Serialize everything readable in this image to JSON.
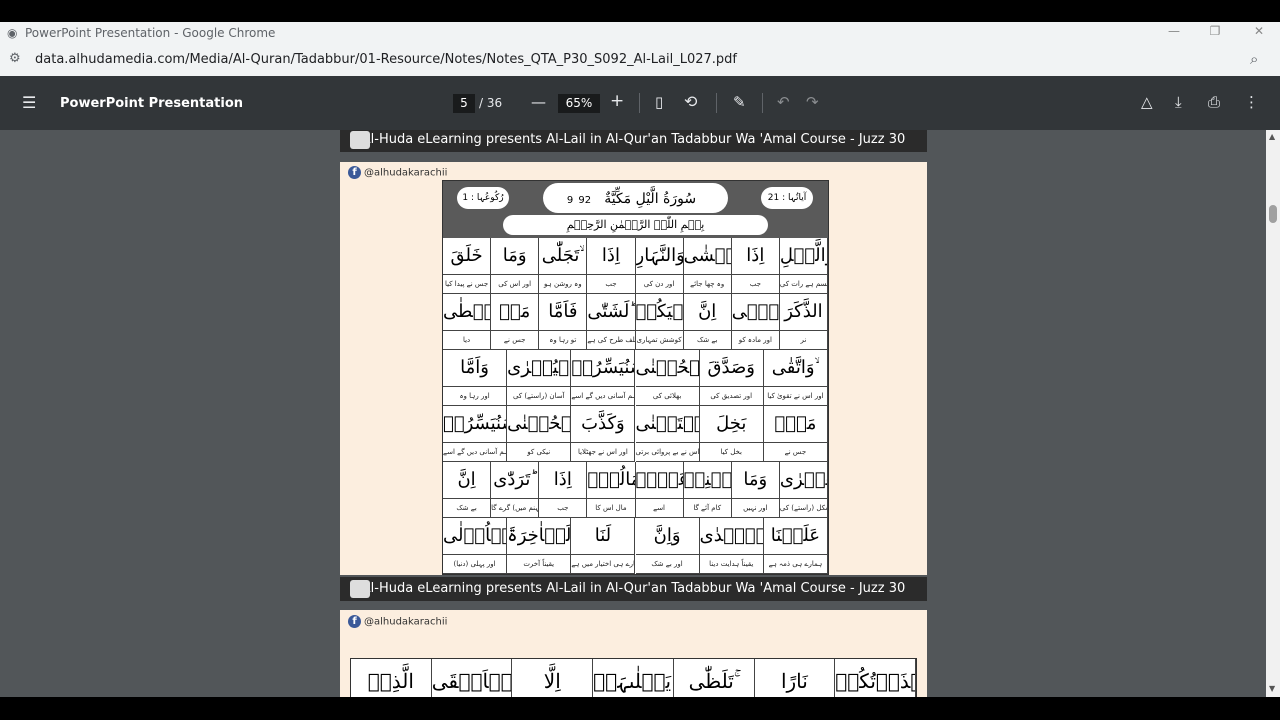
{
  "window": {
    "title": "PowerPoint Presentation - Google Chrome"
  },
  "address": {
    "url": "data.alhudamedia.com/Media/Al-Quran/Tadabbur/01-Resource/Notes/Notes_QTA_P30_S092_Al-Lail_L027.pdf"
  },
  "pdf": {
    "title": "PowerPoint Presentation",
    "page_current": "5",
    "page_total": "/ 36",
    "zoom": "65%"
  },
  "banner": {
    "text": "Al-Huda eLearning presents Al-Lail in Al-Qur'an Tadabbur Wa 'Amal Course - Juzz 30"
  },
  "social": {
    "handle": "@alhudakarachii"
  },
  "surah": {
    "name": "سُورَةُ الَّيْلِ مَكِّيَّةٌ",
    "number": "92",
    "order": "9",
    "ayat": "آیاتُہا : 21",
    "ruku": "رُکُوعُہا : 1",
    "bismillah": "بِسۡمِ اللّٰہِ الرَّحۡمٰنِ الرَّحِیۡمِ"
  },
  "rows": [
    {
      "cells": [
        {
          "ar": "وَالَّیۡلِ",
          "ur": "قسم ہے رات کی"
        },
        {
          "ar": "اِذَا",
          "ur": "جب"
        },
        {
          "ar": "یَغۡشٰی ۙ",
          "ur": "وہ چھا جائے"
        },
        {
          "ar": "وَالنَّہَارِ",
          "ur": "اور دن کی"
        },
        {
          "ar": "اِذَا",
          "ur": "جب"
        },
        {
          "ar": "تَجَلّٰی ۙ",
          "ur": "وہ روشن ہو"
        },
        {
          "ar": "وَمَا",
          "ur": "اور اس کی"
        },
        {
          "ar": "خَلَقَ",
          "ur": "جس نے پیدا کیا"
        }
      ]
    },
    {
      "cells": [
        {
          "ar": "الذَّکَرَ",
          "ur": "نر"
        },
        {
          "ar": "وَالۡاُنۡثٰۤی ۙ",
          "ur": "اور مادہ کو"
        },
        {
          "ar": "اِنَّ",
          "ur": "بے شک"
        },
        {
          "ar": "سَعۡیَکُمۡ",
          "ur": "کوشش تمہاری"
        },
        {
          "ar": "لَشَتّٰی ؕ",
          "ur": "البتہ مختلف طرح کی ہے"
        },
        {
          "ar": "فَاَمَّا",
          "ur": "تو رہا وہ"
        },
        {
          "ar": "مَنۡ",
          "ur": "جس نے"
        },
        {
          "ar": "اَعۡطٰی",
          "ur": "دیا"
        }
      ]
    },
    {
      "cells": [
        {
          "ar": "وَاتَّقٰی ۙ",
          "ur": "اور اس نے تقویٰ کیا"
        },
        {
          "ar": "وَصَدَّقَ",
          "ur": "اور تصدیق کی"
        },
        {
          "ar": "بِالۡحُسۡنٰی ۙ",
          "ur": "بھلائی کی"
        },
        {
          "ar": "فَسَنُیَسِّرُہٗ",
          "ur": "پس عنقریب ہم آسانی دیں گے اسے"
        },
        {
          "ar": "لِلۡیُسۡرٰی ؕ",
          "ur": "آسان (راستے) کی"
        },
        {
          "ar": "وَاَمَّا",
          "ur": "اور رہا وہ"
        }
      ]
    },
    {
      "cells": [
        {
          "ar": "مَنۡۢ",
          "ur": "جس نے"
        },
        {
          "ar": "بَخِلَ",
          "ur": "بخل کیا"
        },
        {
          "ar": "وَاسۡتَغۡنٰی ۙ",
          "ur": "اور اس نے بے پروائی برتی"
        },
        {
          "ar": "وَکَذَّبَ",
          "ur": "اور اس نے جھٹلایا"
        },
        {
          "ar": "بِالۡحُسۡنٰی ۙ",
          "ur": "نیکی کو"
        },
        {
          "ar": "فَسَنُیَسِّرُہٗ",
          "ur": "پس عنقریب ہم آسانی دیں گے اسے"
        }
      ]
    },
    {
      "cells": [
        {
          "ar": "لِلۡعُسۡرٰی ؕ",
          "ur": "مشکل (راستے) کی"
        },
        {
          "ar": "وَمَا",
          "ur": "اور نہیں"
        },
        {
          "ar": "یُغۡنِیۡ",
          "ur": "کام آئے گا"
        },
        {
          "ar": "عَنۡہُ",
          "ur": "اسے"
        },
        {
          "ar": "مَالُہٗۤ",
          "ur": "مال اس کا"
        },
        {
          "ar": "اِذَا",
          "ur": "جب"
        },
        {
          "ar": "تَرَدّٰی ؕ",
          "ur": "وہ (جہنم میں) گرے گا"
        },
        {
          "ar": "اِنَّ",
          "ur": "بے شک"
        }
      ]
    },
    {
      "cells": [
        {
          "ar": "عَلَیۡنَا",
          "ur": "ہمارے ہی ذمہ ہے"
        },
        {
          "ar": "لَلۡہُدٰی ۫ۖ",
          "ur": "یقیناً ہدایت دینا"
        },
        {
          "ar": "وَاِنَّ",
          "ur": "اور بے شک"
        },
        {
          "ar": "لَنَا",
          "ur": "ہمارے ہی اختیار میں ہے"
        },
        {
          "ar": "لَلۡاٰخِرَۃَ",
          "ur": "یقیناً آخرت"
        },
        {
          "ar": "وَالۡاُوۡلٰی",
          "ur": "اور پہلی (دنیا)"
        }
      ]
    }
  ],
  "next_row": {
    "cells": [
      {
        "ar": "فَاَنۡذَرۡتُکُمۡ"
      },
      {
        "ar": "نَارًا"
      },
      {
        "ar": "تَلَظّٰی ۚ"
      },
      {
        "ar": "لَا یَصۡلٰىہَاۤ"
      },
      {
        "ar": "اِلَّا"
      },
      {
        "ar": "الۡاَشۡقَی ۙ"
      },
      {
        "ar": "الَّذِیۡ"
      }
    ]
  },
  "colors": {
    "toolbar": "#323639",
    "viewer": "#525659",
    "page": "#fceedf"
  }
}
